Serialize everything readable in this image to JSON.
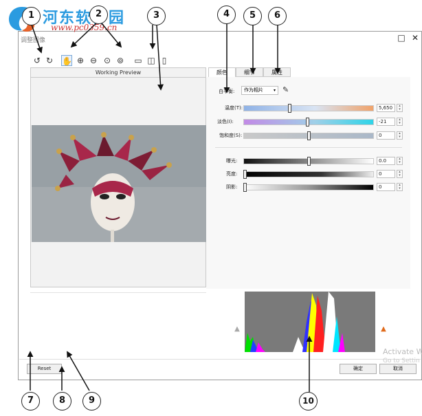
{
  "watermark": {
    "site_name": "河东软件园",
    "url": "www.pc0359.cn"
  },
  "window": {
    "title": "调整图像",
    "maximize_icon": "maximize-icon",
    "close_icon": "close-icon"
  },
  "toolbar": {
    "icons": [
      "rotate-left-icon",
      "rotate-right-icon",
      "pan-hand-icon",
      "zoom-in-icon",
      "zoom-out-icon",
      "zoom-fit-icon",
      "zoom-actual-icon",
      "single-view-icon",
      "split-view-icon",
      "side-by-side-view-icon"
    ]
  },
  "preview": {
    "title": "Working Preview"
  },
  "tabs": [
    {
      "label": "颜色"
    },
    {
      "label": "细节"
    },
    {
      "label": "属性"
    }
  ],
  "white_balance": {
    "label": "白平衡:",
    "value": "作为相片",
    "picker_icon": "eyedropper-icon"
  },
  "sliders": [
    {
      "label": "温度(T):",
      "value": "5,650",
      "level": 0.35
    },
    {
      "label": "淡色(I):",
      "value": "-21",
      "level": 0.49
    },
    {
      "label": "饱和度(S):",
      "value": "0",
      "level": 0.5
    },
    {
      "label": "曝光:",
      "value": "0.0",
      "level": 0.5
    },
    {
      "label": "亮度:",
      "value": "0",
      "level": 0.0
    },
    {
      "label": "阴影:",
      "value": "0",
      "level": 0.0
    }
  ],
  "buttons": {
    "reset": "Reset",
    "ok": "确定",
    "cancel": "取消"
  },
  "system_overlay": {
    "line1": "Activate W",
    "line2": "Go to Settin"
  },
  "callouts": [
    "1",
    "2",
    "3",
    "4",
    "5",
    "6",
    "7",
    "8",
    "9",
    "10"
  ],
  "colors": {
    "accent": "#7aa8d8",
    "callout_border": "#222222",
    "watermark_blue": "#2b9be0",
    "warning": "#e06a1a"
  }
}
